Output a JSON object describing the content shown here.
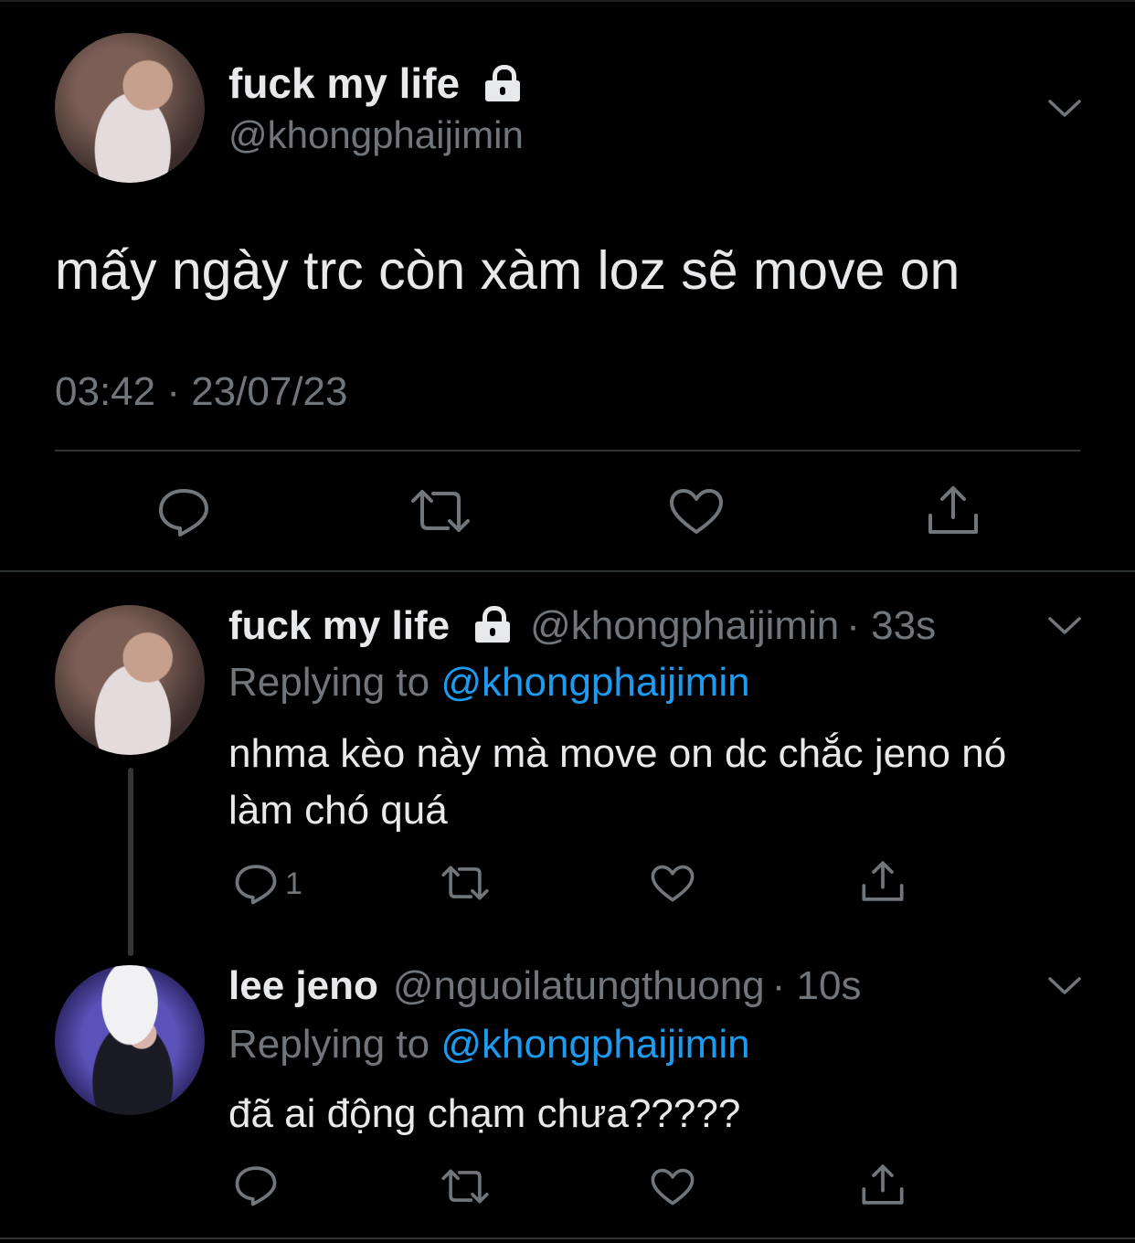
{
  "main_tweet": {
    "display_name": "fuck my life",
    "handle": "@khongphaijimin",
    "text": "mấy ngày trc còn xàm loz sẽ move on",
    "timestamp": "03:42 · 23/07/23",
    "icons": [
      "lock-icon",
      "chevron-down-icon",
      "reply-icon",
      "retweet-icon",
      "like-icon",
      "share-icon"
    ]
  },
  "replies": [
    {
      "display_name": "fuck my life",
      "handle": "@khongphaijimin",
      "time": "· 33s",
      "replying_prefix": "Replying to",
      "replying_handle": "@khongphaijimin",
      "text_line1": "nhma kèo này mà move on dc chắc jeno nó",
      "text_line2": "làm chó quá",
      "reply_count": "1"
    },
    {
      "display_name": "lee jeno",
      "handle": "@nguoilatungthuong",
      "time": "· 10s",
      "replying_prefix": "Replying to",
      "replying_handle": "@khongphaijimin",
      "text": "đã ai động chạm chưa?????"
    }
  ],
  "colors": {
    "background": "#000000",
    "text": "#e7e9ea",
    "secondary": "#71767b",
    "link": "#1d9bf0",
    "divider": "#2f3336"
  }
}
